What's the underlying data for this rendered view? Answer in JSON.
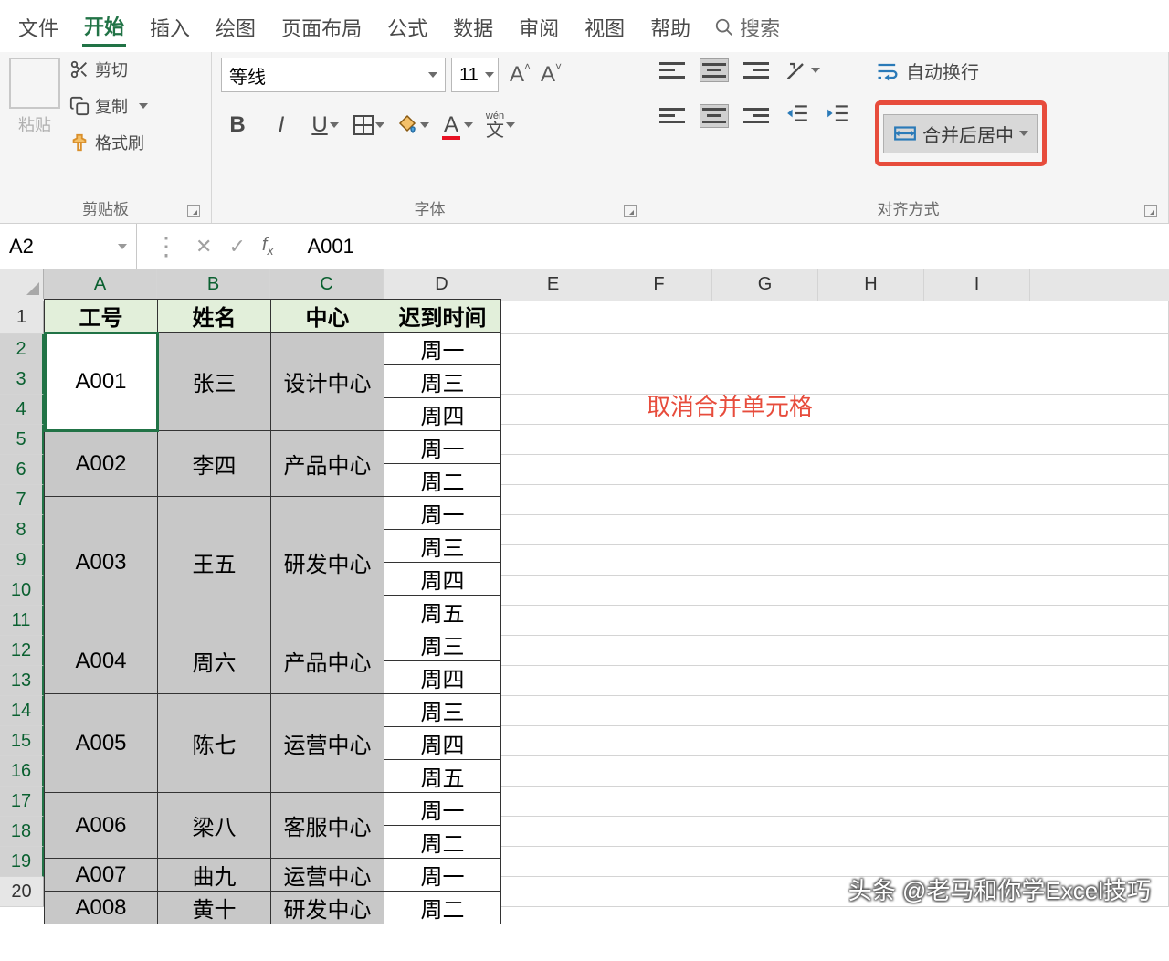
{
  "tabs": {
    "file": "文件",
    "home": "开始",
    "insert": "插入",
    "draw": "绘图",
    "layout": "页面布局",
    "formula": "公式",
    "data": "数据",
    "review": "审阅",
    "view": "视图",
    "help": "帮助",
    "search": "搜索"
  },
  "ribbon": {
    "clipboard": {
      "paste": "粘贴",
      "cut": "剪切",
      "copy": "复制",
      "format_painter": "格式刷",
      "group": "剪贴板"
    },
    "font": {
      "name": "等线",
      "size": "11",
      "bold": "B",
      "italic": "I",
      "underline": "U",
      "ruby_top": "wén",
      "ruby_cn": "文",
      "group": "字体"
    },
    "align": {
      "wrap": "自动换行",
      "merge": "合并后居中",
      "group": "对齐方式"
    }
  },
  "formula_bar": {
    "name_box": "A2",
    "value": "A001"
  },
  "columns": [
    "A",
    "B",
    "C",
    "D",
    "E",
    "F",
    "G",
    "H",
    "I"
  ],
  "row_count": 20,
  "headers": {
    "c1": "工号",
    "c2": "姓名",
    "c3": "中心",
    "c4": "迟到时间"
  },
  "body": [
    {
      "id": "A001",
      "name": "张三",
      "center": "设计中心",
      "days": [
        "周一",
        "周三",
        "周四"
      ]
    },
    {
      "id": "A002",
      "name": "李四",
      "center": "产品中心",
      "days": [
        "周一",
        "周二"
      ]
    },
    {
      "id": "A003",
      "name": "王五",
      "center": "研发中心",
      "days": [
        "周一",
        "周三",
        "周四",
        "周五"
      ]
    },
    {
      "id": "A004",
      "name": "周六",
      "center": "产品中心",
      "days": [
        "周三",
        "周四"
      ]
    },
    {
      "id": "A005",
      "name": "陈七",
      "center": "运营中心",
      "days": [
        "周三",
        "周四",
        "周五"
      ]
    },
    {
      "id": "A006",
      "name": "梁八",
      "center": "客服中心",
      "days": [
        "周一",
        "周二"
      ]
    },
    {
      "id": "A007",
      "name": "曲九",
      "center": "运营中心",
      "days": [
        "周一"
      ]
    },
    {
      "id": "A008",
      "name": "黄十",
      "center": "研发中心",
      "days": [
        "周二"
      ]
    }
  ],
  "annotation": "取消合并单元格",
  "watermark": "头条 @老马和你学Excel技巧"
}
